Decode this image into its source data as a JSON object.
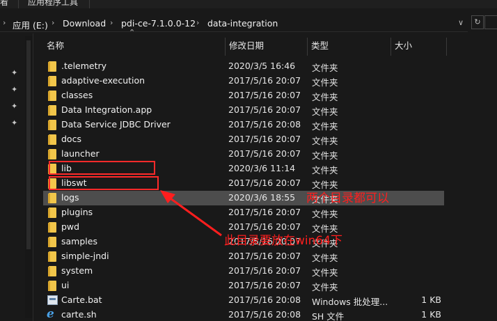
{
  "top_tabs": [
    "看",
    "应用程序工具"
  ],
  "address_bar": {
    "crumbs": [
      "应用 (E:)",
      "Download",
      "pdi-ce-7.1.0.0-12",
      "data-integration"
    ],
    "dropdown_glyph": "∨",
    "refresh_glyph": "↻"
  },
  "columns": {
    "name": "名称",
    "date": "修改日期",
    "type": "类型",
    "size": "大小"
  },
  "files": [
    {
      "name": ".telemetry",
      "date": "2020/3/5 16:46",
      "type": "文件夹",
      "size": "",
      "icon": "folder-icon"
    },
    {
      "name": "adaptive-execution",
      "date": "2017/5/16 20:07",
      "type": "文件夹",
      "size": "",
      "icon": "folder-icon"
    },
    {
      "name": "classes",
      "date": "2017/5/16 20:07",
      "type": "文件夹",
      "size": "",
      "icon": "folder-icon"
    },
    {
      "name": "Data Integration.app",
      "date": "2017/5/16 20:07",
      "type": "文件夹",
      "size": "",
      "icon": "folder-icon"
    },
    {
      "name": "Data Service JDBC Driver",
      "date": "2017/5/16 20:08",
      "type": "文件夹",
      "size": "",
      "icon": "folder-icon"
    },
    {
      "name": "docs",
      "date": "2017/5/16 20:07",
      "type": "文件夹",
      "size": "",
      "icon": "folder-icon"
    },
    {
      "name": "launcher",
      "date": "2017/5/16 20:07",
      "type": "文件夹",
      "size": "",
      "icon": "folder-icon"
    },
    {
      "name": "lib",
      "date": "2020/3/6 11:14",
      "type": "文件夹",
      "size": "",
      "icon": "folder-icon"
    },
    {
      "name": "libswt",
      "date": "2017/5/16 20:07",
      "type": "文件夹",
      "size": "",
      "icon": "folder-icon"
    },
    {
      "name": "logs",
      "date": "2020/3/6 18:55",
      "type": "文件夹",
      "size": "",
      "icon": "folder-icon",
      "selected": true
    },
    {
      "name": "plugins",
      "date": "2017/5/16 20:07",
      "type": "文件夹",
      "size": "",
      "icon": "folder-icon"
    },
    {
      "name": "pwd",
      "date": "2017/5/16 20:07",
      "type": "文件夹",
      "size": "",
      "icon": "folder-icon"
    },
    {
      "name": "samples",
      "date": "2017/5/16 20:07",
      "type": "文件夹",
      "size": "",
      "icon": "folder-icon"
    },
    {
      "name": "simple-jndi",
      "date": "2017/5/16 20:07",
      "type": "文件夹",
      "size": "",
      "icon": "folder-icon"
    },
    {
      "name": "system",
      "date": "2017/5/16 20:07",
      "type": "文件夹",
      "size": "",
      "icon": "folder-icon"
    },
    {
      "name": "ui",
      "date": "2017/5/16 20:07",
      "type": "文件夹",
      "size": "",
      "icon": "folder-icon"
    },
    {
      "name": "Carte.bat",
      "date": "2017/5/16 20:08",
      "type": "Windows 批处理...",
      "size": "1 KB",
      "icon": "batch-file-icon"
    },
    {
      "name": "carte.sh",
      "date": "2017/5/16 20:08",
      "type": "SH 文件",
      "size": "1 KB",
      "icon": "shell-script-icon"
    }
  ],
  "annotations": {
    "note_both_dirs": "两个目录都可以",
    "note_win64": "此目录要放在win64下",
    "color": "#ff1e1e"
  }
}
